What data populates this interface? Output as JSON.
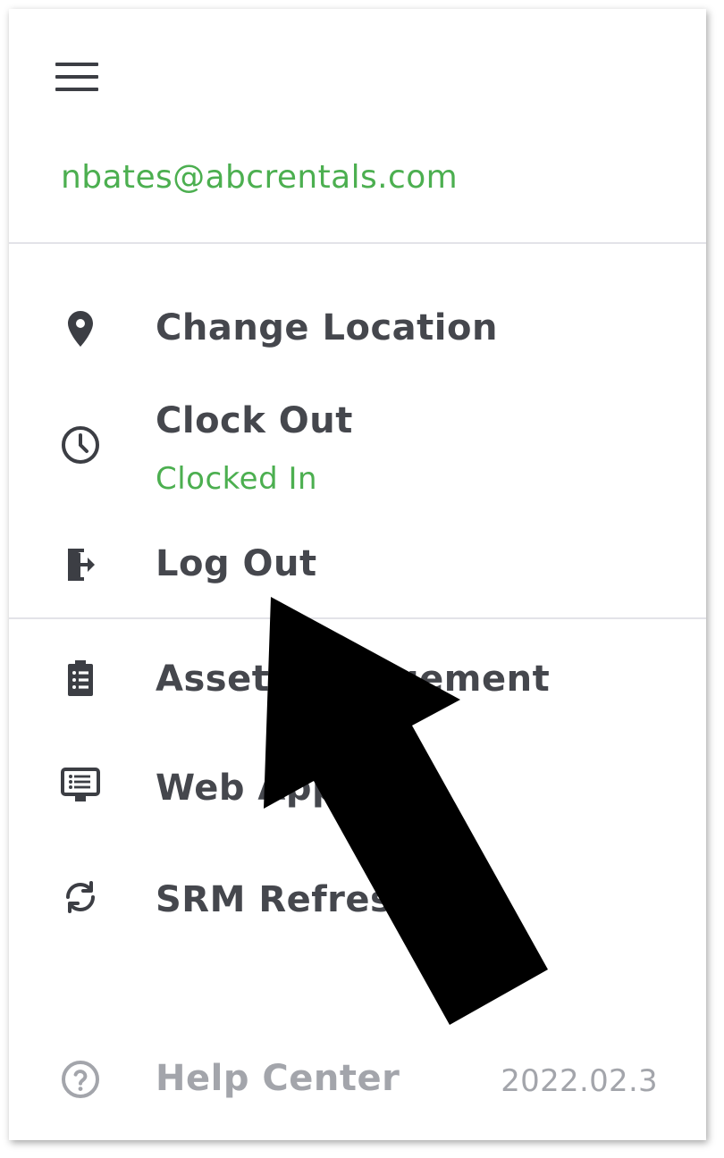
{
  "header": {
    "menu_icon": "hamburger-menu-icon",
    "user_email": "nbates@abcrentals.com"
  },
  "menu": {
    "change_location": {
      "label": "Change Location",
      "icon": "location-pin-icon"
    },
    "clock_out": {
      "label": "Clock Out",
      "status": "Clocked In",
      "icon": "clock-icon"
    },
    "log_out": {
      "label": "Log Out",
      "icon": "exit-door-icon"
    },
    "asset_management": {
      "label": "Asset Management",
      "icon": "clipboard-list-icon"
    },
    "web_app": {
      "label": "Web App",
      "icon": "monitor-list-icon"
    },
    "srm_refresh": {
      "label": "SRM Refresh",
      "icon": "refresh-icon"
    }
  },
  "footer": {
    "help_center": {
      "label": "Help Center",
      "icon": "help-circle-icon"
    },
    "version": "2022.02.3"
  },
  "annotation": {
    "type": "arrow",
    "points_to": "Log Out",
    "color": "#000000"
  },
  "colors": {
    "accent_green": "#4caf50",
    "text_dark": "#45474d",
    "text_muted": "#a3a5ab",
    "divider": "#e3e3e8"
  }
}
